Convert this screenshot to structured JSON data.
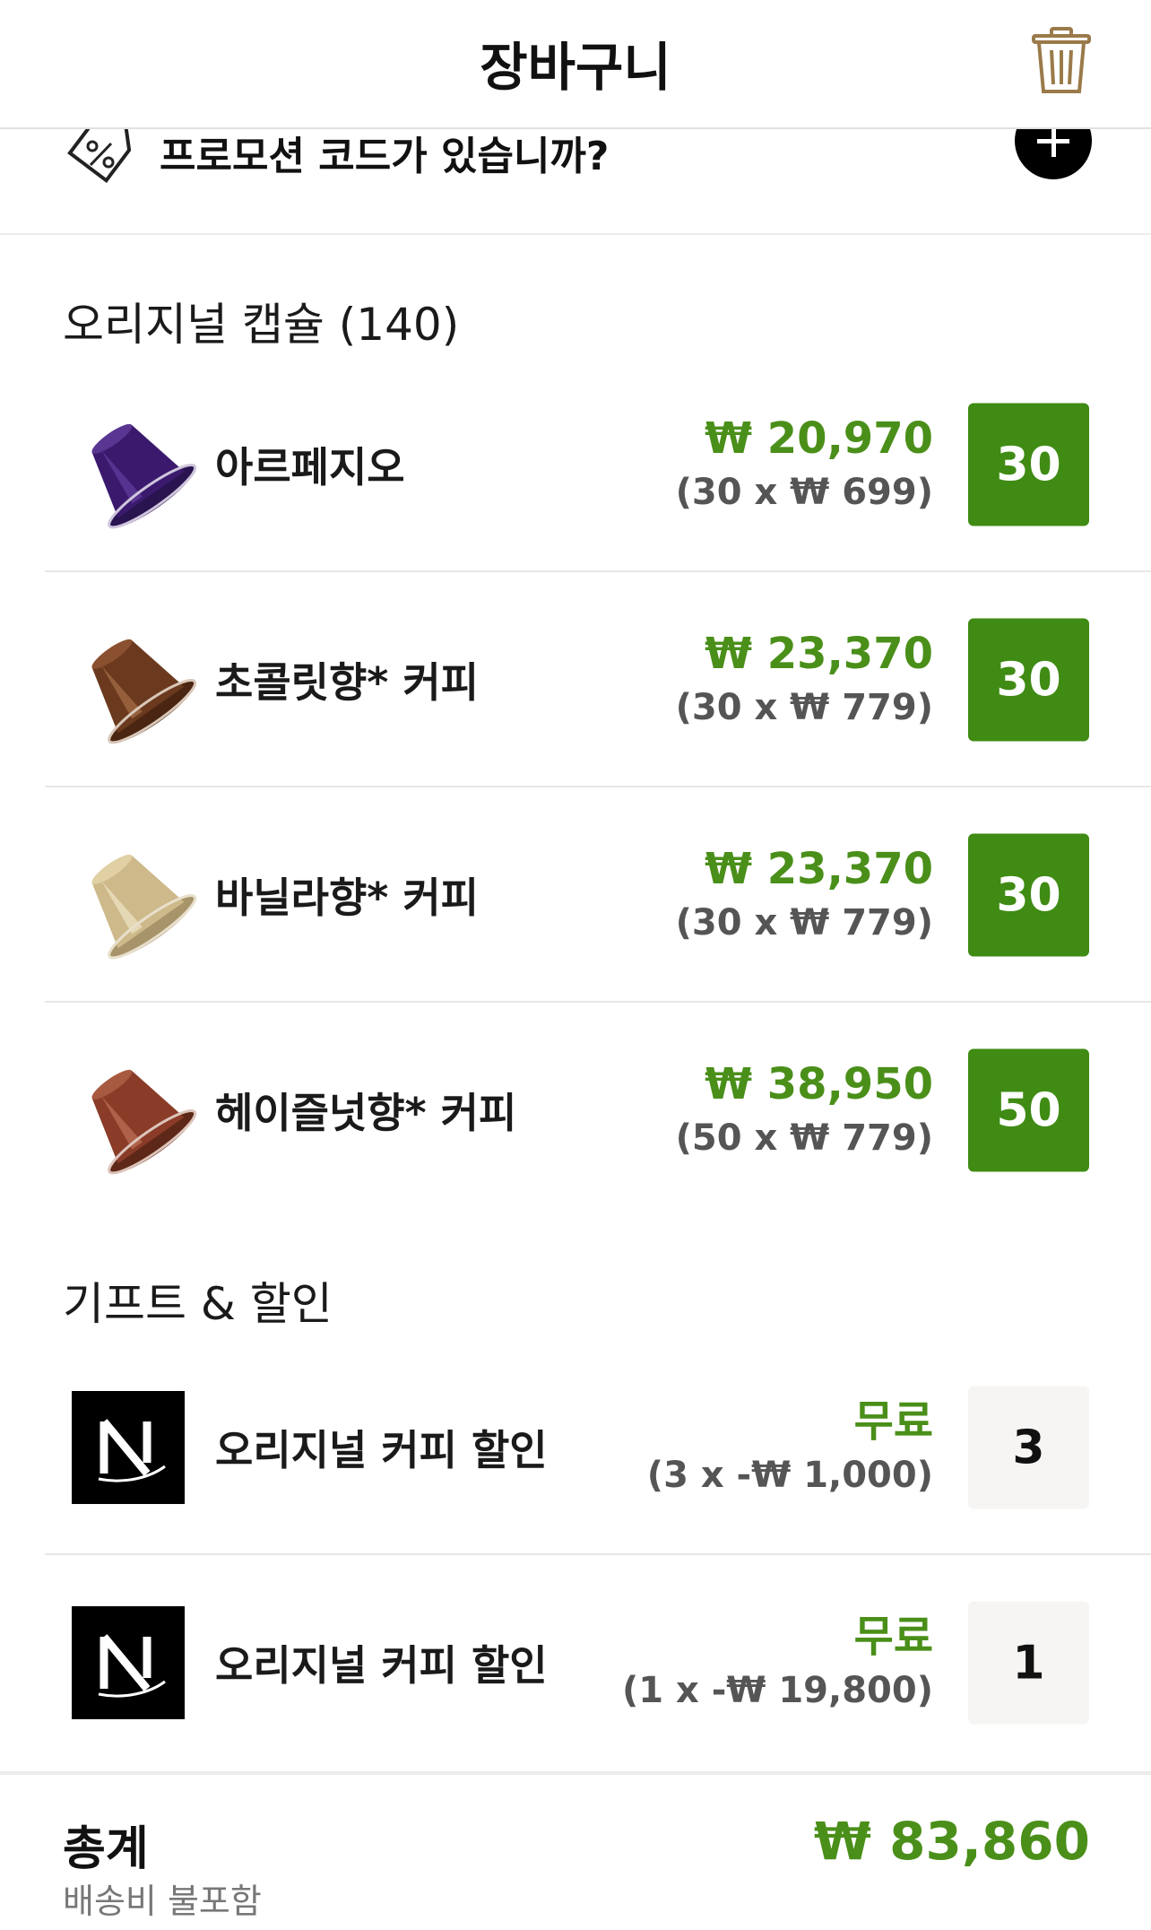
{
  "header": {
    "title": "장바구니"
  },
  "promo": {
    "label": "프로모션 코드가 있습니까?"
  },
  "capsules": {
    "section_title": "오리지널 캡슐 (140)",
    "items": [
      {
        "name": "아르페지오",
        "price": "₩ 20,970",
        "unit": "(30 x ₩ 699)",
        "qty": "30",
        "color": "#3b1a6e"
      },
      {
        "name": "초콜릿향* 커피",
        "price": "₩ 23,370",
        "unit": "(30 x ₩ 779)",
        "qty": "30",
        "color": "#6b3a1e"
      },
      {
        "name": "바닐라향* 커피",
        "price": "₩ 23,370",
        "unit": "(30 x ₩ 779)",
        "qty": "30",
        "color": "#cdb98a"
      },
      {
        "name": "헤이즐넛향* 커피",
        "price": "₩ 38,950",
        "unit": "(50 x ₩ 779)",
        "qty": "50",
        "color": "#8a3c28"
      }
    ]
  },
  "gifts": {
    "section_title": "기프트 & 할인",
    "items": [
      {
        "name": "오리지널 커피 할인",
        "price": "무료",
        "unit": "(3 x -₩ 1,000)",
        "qty": "3"
      },
      {
        "name": "오리지널 커피 할인",
        "price": "무료",
        "unit": "(1 x -₩ 19,800)",
        "qty": "1"
      }
    ]
  },
  "footer": {
    "total_label": "총계",
    "shipping_note": "배송비 불포함",
    "total_amount": "₩ 83,860"
  },
  "colors": {
    "accent_green": "#3f8b14",
    "price_green": "#4a8f19",
    "trash_gold": "#9a7a4a"
  }
}
